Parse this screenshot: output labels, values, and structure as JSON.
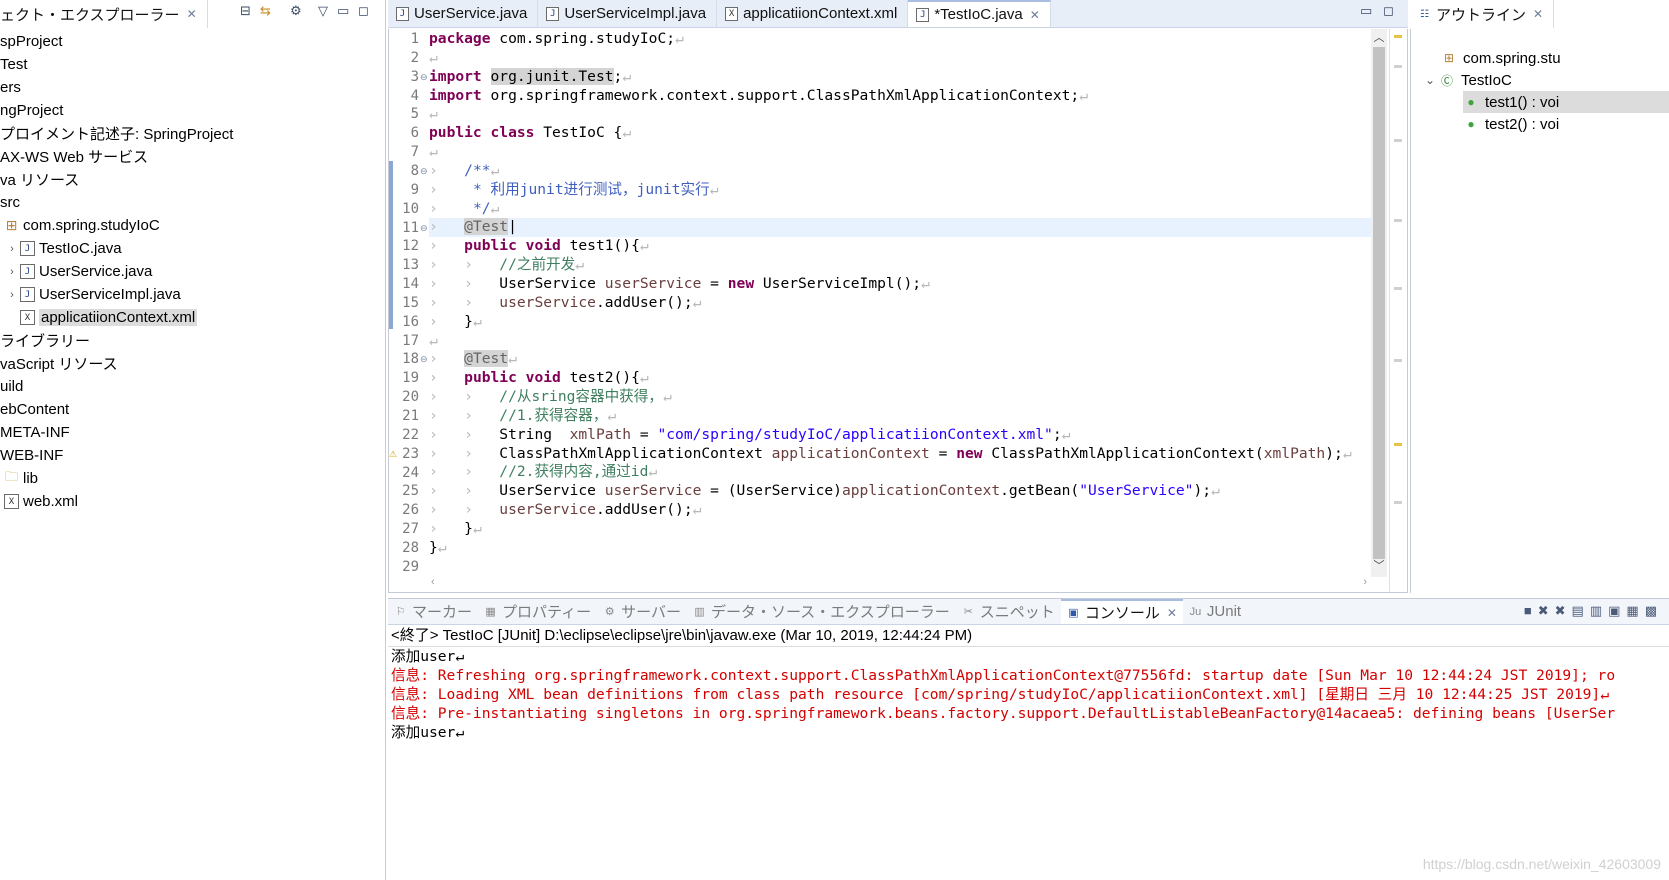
{
  "explorer": {
    "tab_label": "ェクト・エクスプローラー",
    "tree": [
      {
        "indent": 0,
        "tw": "",
        "icon": "",
        "label": "spProject"
      },
      {
        "indent": 0,
        "tw": "",
        "icon": "",
        "label": "Test"
      },
      {
        "indent": 0,
        "tw": "",
        "icon": "",
        "label": "ers"
      },
      {
        "indent": 0,
        "tw": "",
        "icon": "",
        "label": "ngProject"
      },
      {
        "indent": 0,
        "tw": "",
        "icon": "",
        "label": "プロイメント記述子: SpringProject"
      },
      {
        "indent": 0,
        "tw": "",
        "icon": "",
        "label": "AX-WS Web サービス"
      },
      {
        "indent": 0,
        "tw": "",
        "icon": "",
        "label": "va リソース"
      },
      {
        "indent": 0,
        "tw": "",
        "icon": "",
        "label": "src"
      },
      {
        "indent": 0,
        "tw": "",
        "icon": "pkg",
        "label": "com.spring.studyIoC"
      },
      {
        "indent": 1,
        "tw": "›",
        "icon": "java",
        "label": "TestIoC.java"
      },
      {
        "indent": 1,
        "tw": "›",
        "icon": "java",
        "label": "UserService.java"
      },
      {
        "indent": 1,
        "tw": "›",
        "icon": "java",
        "label": "UserServiceImpl.java"
      },
      {
        "indent": 1,
        "tw": "",
        "icon": "xml",
        "label": "applicatiionContext.xml",
        "selected": true
      },
      {
        "indent": 0,
        "tw": "",
        "icon": "",
        "label": "ライブラリー"
      },
      {
        "indent": 0,
        "tw": "",
        "icon": "",
        "label": "vaScript リソース"
      },
      {
        "indent": 0,
        "tw": "",
        "icon": "",
        "label": "uild"
      },
      {
        "indent": 0,
        "tw": "",
        "icon": "",
        "label": "ebContent"
      },
      {
        "indent": 0,
        "tw": "",
        "icon": "",
        "label": "META-INF"
      },
      {
        "indent": 0,
        "tw": "",
        "icon": "",
        "label": "WEB-INF"
      },
      {
        "indent": 0,
        "tw": "",
        "icon": "folder",
        "label": "lib"
      },
      {
        "indent": 0,
        "tw": "",
        "icon": "xml",
        "label": "web.xml"
      }
    ]
  },
  "editor": {
    "tabs": [
      {
        "label": "UserService.java",
        "icon": "java"
      },
      {
        "label": "UserServiceImpl.java",
        "icon": "java"
      },
      {
        "label": "applicatiionContext.xml",
        "icon": "xml"
      },
      {
        "label": "*TestIoC.java",
        "icon": "java",
        "active": true
      }
    ],
    "lines": [
      {
        "n": "1",
        "html": "<span class='kw'>package</span> com.spring.studyIoC;<span class='ws'>↵</span>"
      },
      {
        "n": "2",
        "html": "<span class='ws'>↵</span>"
      },
      {
        "n": "3",
        "fold": "⊖",
        "html": "<span class='kw'>import</span> <span class='hl'>org.junit.Test</span>;<span class='ws'>↵</span>"
      },
      {
        "n": "4",
        "html": "<span class='kw'>import</span> org.springframework.context.support.ClassPathXmlApplicationContext;<span class='ws'>↵</span>"
      },
      {
        "n": "5",
        "html": "<span class='ws'>↵</span>"
      },
      {
        "n": "6",
        "html": "<span class='kw'>public</span> <span class='kw'>class</span> TestIoC {<span class='ws'>↵</span>"
      },
      {
        "n": "7",
        "html": "<span class='ws'>↵</span>"
      },
      {
        "n": "8",
        "fold": "⊖",
        "html": "<span class='ws'>›   </span><span class='doc'>/**</span><span class='ws'>↵</span>"
      },
      {
        "n": "9",
        "html": "<span class='ws'>›   </span><span class='doc'> * 利用junit进行测试，junit实行</span><span class='ws'>↵</span>"
      },
      {
        "n": "10",
        "html": "<span class='ws'>›   </span><span class='doc'> */</span><span class='ws'>↵</span>"
      },
      {
        "n": "11",
        "fold": "⊖",
        "cur": true,
        "html": "<span class='ws'>›   </span><span class='ann'>@Test</span>|"
      },
      {
        "n": "12",
        "html": "<span class='ws'>›   </span><span class='kw'>public</span> <span class='kw'>void</span> test1(){<span class='ws'>↵</span>"
      },
      {
        "n": "13",
        "html": "<span class='ws'>›   ›   </span><span class='cm'>//之前开发</span><span class='ws'>↵</span>"
      },
      {
        "n": "14",
        "html": "<span class='ws'>›   ›   </span>UserService <span class='fld'>userService</span> = <span class='kw'>new</span> UserServiceImpl();<span class='ws'>↵</span>"
      },
      {
        "n": "15",
        "html": "<span class='ws'>›   ›   </span><span class='fld'>userService</span>.addUser();<span class='ws'>↵</span>"
      },
      {
        "n": "16",
        "html": "<span class='ws'>›   </span>}<span class='ws'>↵</span>"
      },
      {
        "n": "17",
        "html": "<span class='ws'>↵</span>"
      },
      {
        "n": "18",
        "fold": "⊖",
        "html": "<span class='ws'>›   </span><span class='ann'>@Test</span><span class='ws'>↵</span>"
      },
      {
        "n": "19",
        "html": "<span class='ws'>›   </span><span class='kw'>public</span> <span class='kw'>void</span> test2(){<span class='ws'>↵</span>"
      },
      {
        "n": "20",
        "html": "<span class='ws'>›   ›   </span><span class='cm'>//从sring容器中获得，</span><span class='ws'>↵</span>"
      },
      {
        "n": "21",
        "html": "<span class='ws'>›   ›   </span><span class='cm'>//1.获得容器，</span><span class='ws'>↵</span>"
      },
      {
        "n": "22",
        "html": "<span class='ws'>›   ›   </span>String  <span class='fld'>xmlPath</span> = <span class='str'>\"com/spring/studyIoC/applicatiionContext.xml\"</span>;<span class='ws'>↵</span>"
      },
      {
        "n": "23",
        "warn": true,
        "html": "<span class='ws'>›   ›   </span>ClassPathXmlApplicationContext <span class='fld'>applicationContext</span> = <span class='kw'>new</span> ClassPathXmlApplicationContext(<span class='fld'>xmlPath</span>);<span class='ws'>↵</span>"
      },
      {
        "n": "24",
        "html": "<span class='ws'>›   ›   </span><span class='cm'>//2.获得内容,通过id</span><span class='ws'>↵</span>"
      },
      {
        "n": "25",
        "html": "<span class='ws'>›   ›   </span>UserService <span class='fld'>userService</span> = (UserService)<span class='fld'>applicationContext</span>.getBean(<span class='str'>\"UserService\"</span>);<span class='ws'>↵</span>"
      },
      {
        "n": "26",
        "html": "<span class='ws'>›   ›   </span><span class='fld'>userService</span>.addUser();<span class='ws'>↵</span>"
      },
      {
        "n": "27",
        "html": "<span class='ws'>›   </span>}<span class='ws'>↵</span>"
      },
      {
        "n": "28",
        "html": "}<span class='ws'>↵</span>"
      },
      {
        "n": "29",
        "html": ""
      }
    ]
  },
  "outline": {
    "tab_label": "アウトライン",
    "items": [
      {
        "icon": "pkg",
        "label": "com.spring.stu",
        "twisty": ""
      },
      {
        "icon": "class",
        "label": "TestIoC",
        "twisty": "⌄"
      },
      {
        "icon": "method",
        "label": "test1() : voi",
        "selected": true
      },
      {
        "icon": "method",
        "label": "test2() : voi"
      }
    ]
  },
  "bottom": {
    "tabs": [
      {
        "label": "マーカー",
        "icon": "⚐"
      },
      {
        "label": "プロパティー",
        "icon": "▦"
      },
      {
        "label": "サーバー",
        "icon": "⚙"
      },
      {
        "label": "データ・ソース・エクスプローラー",
        "icon": "▥"
      },
      {
        "label": "スニペット",
        "icon": "✂"
      },
      {
        "label": "コンソール",
        "icon": "▣",
        "active": true
      },
      {
        "label": "JUnit",
        "icon": "Ju"
      }
    ],
    "console_title": "<終了> TestIoC [JUnit] D:\\eclipse\\eclipse\\jre\\bin\\javaw.exe (Mar 10, 2019, 12:44:24 PM)",
    "lines": [
      {
        "text": "添加user↵",
        "err": false
      },
      {
        "text": "信息: Refreshing org.springframework.context.support.ClassPathXmlApplicationContext@77556fd: startup date [Sun Mar 10 12:44:24 JST 2019]; ro",
        "err": true
      },
      {
        "text": "信息: Loading XML bean definitions from class path resource [com/spring/studyIoC/applicatiionContext.xml] [星期日 三月 10 12:44:25 JST 2019]↵",
        "err": true
      },
      {
        "text": "信息: Pre-instantiating singletons in org.springframework.beans.factory.support.DefaultListableBeanFactory@14acaea5: defining beans [UserSer",
        "err": true
      },
      {
        "text": "添加user↵",
        "err": false
      }
    ],
    "watermark": "https://blog.csdn.net/weixin_42603009"
  }
}
